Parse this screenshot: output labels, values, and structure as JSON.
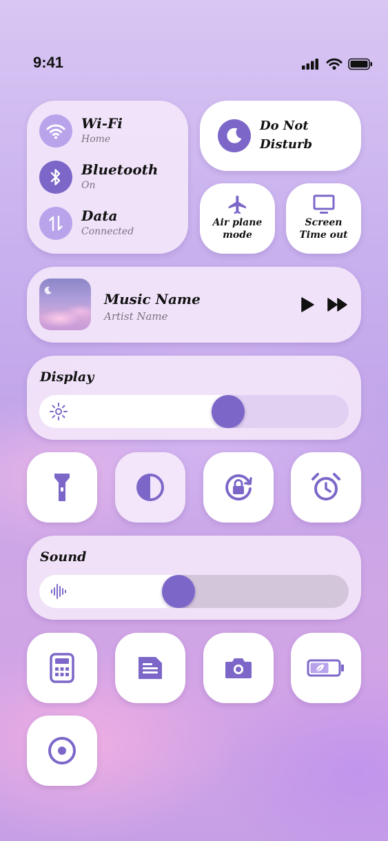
{
  "status_bar": {
    "time": "9:41"
  },
  "connectivity": {
    "wifi": {
      "label": "Wi-Fi",
      "status": "Home"
    },
    "bluetooth": {
      "label": "Bluetooth",
      "status": "On"
    },
    "data": {
      "label": "Data",
      "status": "Connected"
    }
  },
  "do_not_disturb": {
    "line1": "Do Not",
    "line2": "Disturb"
  },
  "airplane": {
    "line1": "Air plane",
    "line2": "mode"
  },
  "screen_timeout": {
    "line1": "Screen",
    "line2": "Time out"
  },
  "music": {
    "title": "Music Name",
    "artist": "Artist Name"
  },
  "display": {
    "label": "Display",
    "level": 0.61
  },
  "sound": {
    "label": "Sound",
    "level": 0.45
  },
  "quick_toggles": [
    "flashlight-icon",
    "contrast-icon",
    "rotation-lock-icon",
    "alarm-clock-icon"
  ],
  "app_shortcuts": [
    "calculator-icon",
    "notes-icon",
    "camera-icon",
    "battery-saver-icon",
    "record-icon"
  ],
  "colors": {
    "accent": "#7c67c9",
    "card": "#f3e6fa",
    "light_accent": "#b9a4ec"
  }
}
